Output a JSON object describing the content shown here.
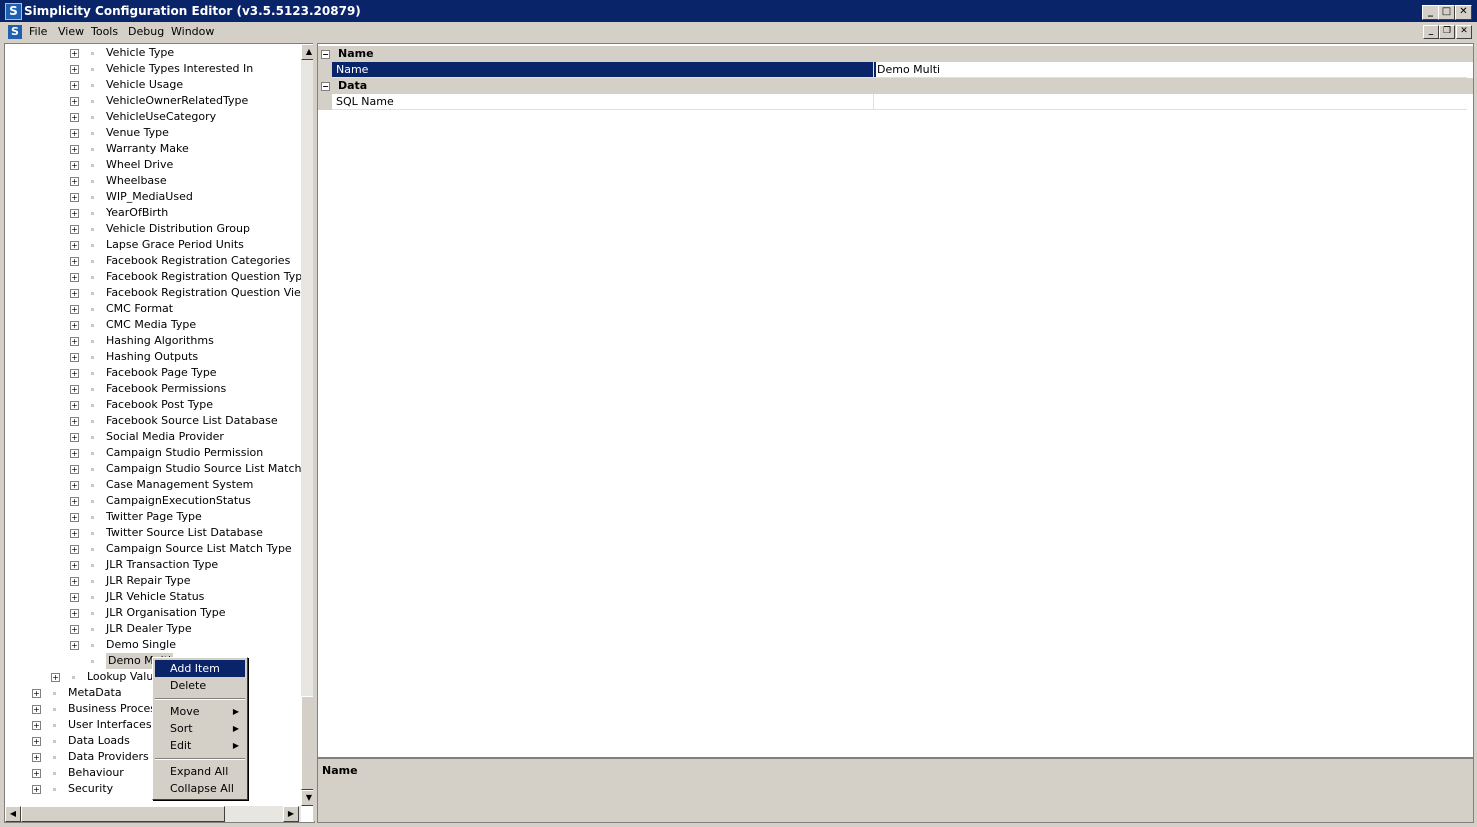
{
  "window": {
    "title": "Simplicity Configuration Editor (v3.5.5123.20879)"
  },
  "menu": [
    "File",
    "View",
    "Tools",
    "Debug",
    "Window"
  ],
  "tree": {
    "items": [
      {
        "label": "Vehicle Type",
        "expander": "+"
      },
      {
        "label": "Vehicle Types Interested In",
        "expander": "+"
      },
      {
        "label": "Vehicle Usage",
        "expander": "+"
      },
      {
        "label": "VehicleOwnerRelatedType",
        "expander": "+"
      },
      {
        "label": "VehicleUseCategory",
        "expander": "+"
      },
      {
        "label": "Venue Type",
        "expander": "+"
      },
      {
        "label": "Warranty Make",
        "expander": "+"
      },
      {
        "label": "Wheel Drive",
        "expander": "+"
      },
      {
        "label": "Wheelbase",
        "expander": "+"
      },
      {
        "label": "WIP_MediaUsed",
        "expander": "+"
      },
      {
        "label": "YearOfBirth",
        "expander": "+"
      },
      {
        "label": "Vehicle Distribution Group",
        "expander": "+"
      },
      {
        "label": "Lapse Grace Period Units",
        "expander": "+"
      },
      {
        "label": "Facebook Registration Categories",
        "expander": "+"
      },
      {
        "label": "Facebook Registration Question Types",
        "expander": "+"
      },
      {
        "label": "Facebook Registration Question View",
        "expander": "+"
      },
      {
        "label": "CMC Format",
        "expander": "+"
      },
      {
        "label": "CMC Media Type",
        "expander": "+"
      },
      {
        "label": "Hashing Algorithms",
        "expander": "+"
      },
      {
        "label": "Hashing Outputs",
        "expander": "+"
      },
      {
        "label": "Facebook Page Type",
        "expander": "+"
      },
      {
        "label": "Facebook Permissions",
        "expander": "+"
      },
      {
        "label": "Facebook Post Type",
        "expander": "+"
      },
      {
        "label": "Facebook Source List Database",
        "expander": "+"
      },
      {
        "label": "Social Media Provider",
        "expander": "+"
      },
      {
        "label": "Campaign Studio Permission",
        "expander": "+"
      },
      {
        "label": "Campaign Studio Source List Match Typ",
        "expander": "+"
      },
      {
        "label": "Case Management System",
        "expander": "+"
      },
      {
        "label": "CampaignExecutionStatus",
        "expander": "+"
      },
      {
        "label": "Twitter Page Type",
        "expander": "+"
      },
      {
        "label": "Twitter Source List Database",
        "expander": "+"
      },
      {
        "label": "Campaign Source List Match Type",
        "expander": "+"
      },
      {
        "label": "JLR Transaction Type",
        "expander": "+"
      },
      {
        "label": "JLR Repair Type",
        "expander": "+"
      },
      {
        "label": "JLR Vehicle Status",
        "expander": "+"
      },
      {
        "label": "JLR Organisation Type",
        "expander": "+"
      },
      {
        "label": "JLR Dealer Type",
        "expander": "+"
      },
      {
        "label": "Demo Single",
        "expander": "+"
      },
      {
        "label": "Demo Multi",
        "expander": ""
      }
    ],
    "lookup": "Lookup Value",
    "roots": [
      "MetaData",
      "Business Process",
      "User Interfaces",
      "Data Loads",
      "Data Providers",
      "Behaviour",
      "Security"
    ]
  },
  "properties": {
    "categories": [
      {
        "name": "Name",
        "rows": [
          {
            "name": "Name",
            "value": "Demo Multi"
          }
        ]
      },
      {
        "name": "Data",
        "rows": [
          {
            "name": "SQL Name",
            "value": ""
          }
        ]
      }
    ],
    "description_title": "Name"
  },
  "context_menu": {
    "add_item": "Add Item",
    "delete": "Delete",
    "move": "Move",
    "sort": "Sort",
    "edit": "Edit",
    "expand_all": "Expand All",
    "collapse_all": "Collapse All"
  },
  "colors": {
    "titlebar": "#0a246a",
    "selection": "#0a246a",
    "chrome": "#d4d0c8"
  }
}
